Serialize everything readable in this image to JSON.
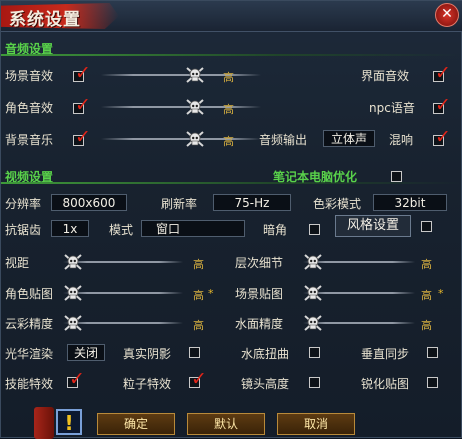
{
  "window": {
    "title": "系统设置",
    "close_label": "✕"
  },
  "audio": {
    "section_label": "音频设置",
    "rows": [
      {
        "label": "场景音效",
        "level": "高"
      },
      {
        "label": "角色音效",
        "level": "高"
      },
      {
        "label": "背景音乐",
        "level": "高"
      }
    ],
    "right_labels": {
      "ui_sound": "界面音效",
      "npc_voice": "npc语音",
      "output": "音频输出",
      "reverb": "混响"
    },
    "output_value": "立体声"
  },
  "video": {
    "section_label": "视频设置",
    "laptop_opt": "笔记本电脑优化",
    "resolution_label": "分辨率",
    "resolution_value": "800x600",
    "refresh_label": "刷新率",
    "refresh_value": "75-Hz",
    "color_label": "色彩模式",
    "color_value": "32bit",
    "aa_label": "抗锯齿",
    "aa_value": "1x",
    "mode_label": "模式",
    "mode_value": "窗口",
    "dark_corner": "暗角",
    "style_button": "风格设置",
    "sliders": [
      {
        "label": "视距",
        "level": "高"
      },
      {
        "label": "层次细节",
        "level": "高"
      },
      {
        "label": "角色贴图",
        "level": "高"
      },
      {
        "label": "场景贴图",
        "level": "高"
      },
      {
        "label": "云彩精度",
        "level": "高"
      },
      {
        "label": "水面精度",
        "level": "高"
      }
    ],
    "star": "*",
    "glow_label": "光华渲染",
    "glow_value": "关闭",
    "real_shadow": "真实阴影",
    "underwater": "水底扭曲",
    "vsync": "垂直同步",
    "skill_fx": "技能特效",
    "particle_fx": "粒子特效",
    "cam_height": "镜头高度",
    "sharpen": "锐化贴图"
  },
  "buttons": {
    "confirm": "确定",
    "default": "默认",
    "cancel": "取消",
    "warning": "!"
  },
  "colors": {
    "section": "#59d24a",
    "check": "#e02418",
    "title_brush": "#c72a1c",
    "level_text": "#d8b040"
  },
  "levels": {
    "audio_sliders": [
      0.6,
      0.6,
      0.6
    ],
    "video_sliders": [
      0.0,
      0.0,
      0.0,
      0.0,
      0.0,
      0.0
    ]
  },
  "toggles": {
    "ui_sound": true,
    "npc_voice": true,
    "reverb": true,
    "scene_sound": true,
    "char_sound": true,
    "bg_music": true,
    "laptop_opt": false,
    "dark_corner": false,
    "style": false,
    "real_shadow": false,
    "underwater": false,
    "vsync": false,
    "skill_fx": true,
    "particle_fx": true,
    "cam_height": false,
    "sharpen": false
  }
}
